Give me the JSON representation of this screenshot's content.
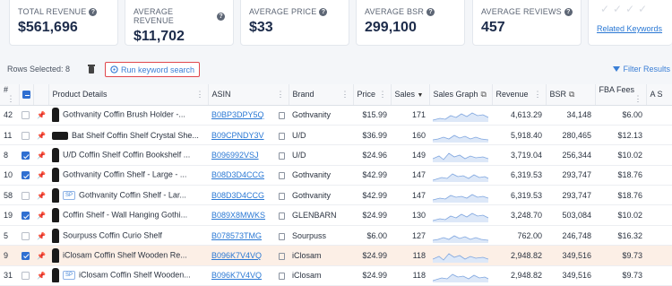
{
  "cards": [
    {
      "label": "TOTAL REVENUE",
      "value": "$561,696"
    },
    {
      "label": "AVERAGE REVENUE",
      "value": "$11,702"
    },
    {
      "label": "AVERAGE PRICE",
      "value": "$33"
    },
    {
      "label": "AVERAGE BSR",
      "value": "299,100"
    },
    {
      "label": "AVERAGE REVIEWS",
      "value": "457"
    }
  ],
  "related_keywords": "Related Keywords",
  "toolbar": {
    "rows_selected": "Rows Selected: 8",
    "run_keyword_search": "Run keyword search",
    "filter_results": "Filter Results"
  },
  "columns": [
    "#",
    "Product Details",
    "ASIN",
    "Brand",
    "Price",
    "Sales",
    "Sales Graph",
    "Revenue",
    "BSR",
    "FBA Fees",
    "A S"
  ],
  "rows": [
    {
      "num": "42",
      "checked": false,
      "thumb": "tall",
      "sp": false,
      "product": "Gothvanity Coffin Brush Holder -...",
      "asin": "B0BP3DPY5Q",
      "brand": "Gothvanity",
      "price": "$15.99",
      "sales": "171",
      "revenue": "4,613.29",
      "bsr": "34,148",
      "fba": "$6.00",
      "hl": false
    },
    {
      "num": "11",
      "checked": false,
      "thumb": "wide",
      "sp": false,
      "product": "Bat Shelf Coffin Shelf Crystal She...",
      "asin": "B09CPNDY3V",
      "brand": "U/D",
      "price": "$36.99",
      "sales": "160",
      "revenue": "5,918.40",
      "bsr": "280,465",
      "fba": "$12.13",
      "hl": false
    },
    {
      "num": "8",
      "checked": true,
      "thumb": "tall",
      "sp": false,
      "product": "U/D Coffin Shelf Coffin Bookshelf ...",
      "asin": "B096992VSJ",
      "brand": "U/D",
      "price": "$24.96",
      "sales": "149",
      "revenue": "3,719.04",
      "bsr": "256,344",
      "fba": "$10.02",
      "hl": false
    },
    {
      "num": "10",
      "checked": true,
      "thumb": "tall",
      "sp": false,
      "product": "Gothvanity Coffin Shelf - Large - ...",
      "asin": "B08D3D4CCG",
      "brand": "Gothvanity",
      "price": "$42.99",
      "sales": "147",
      "revenue": "6,319.53",
      "bsr": "293,747",
      "fba": "$18.76",
      "hl": false
    },
    {
      "num": "58",
      "checked": false,
      "thumb": "tall",
      "sp": true,
      "product": "Gothvanity Coffin Shelf - Lar...",
      "asin": "B08D3D4CCG",
      "brand": "Gothvanity",
      "price": "$42.99",
      "sales": "147",
      "revenue": "6,319.53",
      "bsr": "293,747",
      "fba": "$18.76",
      "hl": false
    },
    {
      "num": "19",
      "checked": true,
      "thumb": "tall",
      "sp": false,
      "product": "Coffin Shelf - Wall Hanging Gothi...",
      "asin": "B089X8MWKS",
      "brand": "GLENBARN",
      "price": "$24.99",
      "sales": "130",
      "revenue": "3,248.70",
      "bsr": "503,084",
      "fba": "$10.02",
      "hl": false
    },
    {
      "num": "5",
      "checked": false,
      "thumb": "tall",
      "sp": false,
      "product": "Sourpuss Coffin Curio Shelf",
      "asin": "B078573TMG",
      "brand": "Sourpuss",
      "price": "$6.00",
      "sales": "127",
      "revenue": "762.00",
      "bsr": "246,748",
      "fba": "$16.32",
      "hl": false
    },
    {
      "num": "9",
      "checked": true,
      "thumb": "tall",
      "sp": false,
      "product": "iClosam Coffin Shelf Wooden Re...",
      "asin": "B096K7V4VQ",
      "brand": "iClosam",
      "price": "$24.99",
      "sales": "118",
      "revenue": "2,948.82",
      "bsr": "349,516",
      "fba": "$9.73",
      "hl": true
    },
    {
      "num": "31",
      "checked": false,
      "thumb": "tall",
      "sp": true,
      "product": "iClosam Coffin Shelf Wooden...",
      "asin": "B096K7V4VQ",
      "brand": "iClosam",
      "price": "$24.99",
      "sales": "118",
      "revenue": "2,948.82",
      "bsr": "349,516",
      "fba": "$9.73",
      "hl": false
    }
  ]
}
